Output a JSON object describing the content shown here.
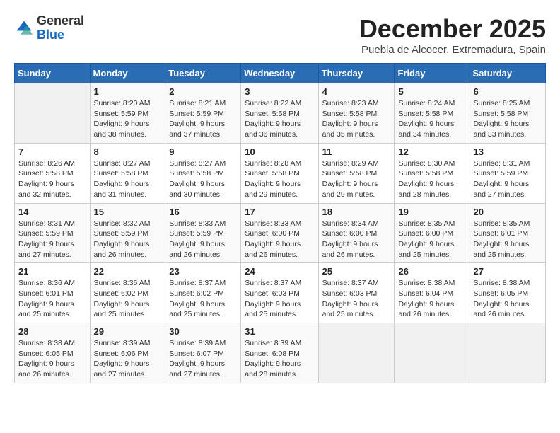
{
  "logo": {
    "general": "General",
    "blue": "Blue"
  },
  "header": {
    "month": "December 2025",
    "location": "Puebla de Alcocer, Extremadura, Spain"
  },
  "weekdays": [
    "Sunday",
    "Monday",
    "Tuesday",
    "Wednesday",
    "Thursday",
    "Friday",
    "Saturday"
  ],
  "weeks": [
    [
      {
        "day": "",
        "info": ""
      },
      {
        "day": "1",
        "info": "Sunrise: 8:20 AM\nSunset: 5:59 PM\nDaylight: 9 hours\nand 38 minutes."
      },
      {
        "day": "2",
        "info": "Sunrise: 8:21 AM\nSunset: 5:59 PM\nDaylight: 9 hours\nand 37 minutes."
      },
      {
        "day": "3",
        "info": "Sunrise: 8:22 AM\nSunset: 5:58 PM\nDaylight: 9 hours\nand 36 minutes."
      },
      {
        "day": "4",
        "info": "Sunrise: 8:23 AM\nSunset: 5:58 PM\nDaylight: 9 hours\nand 35 minutes."
      },
      {
        "day": "5",
        "info": "Sunrise: 8:24 AM\nSunset: 5:58 PM\nDaylight: 9 hours\nand 34 minutes."
      },
      {
        "day": "6",
        "info": "Sunrise: 8:25 AM\nSunset: 5:58 PM\nDaylight: 9 hours\nand 33 minutes."
      }
    ],
    [
      {
        "day": "7",
        "info": "Sunrise: 8:26 AM\nSunset: 5:58 PM\nDaylight: 9 hours\nand 32 minutes."
      },
      {
        "day": "8",
        "info": "Sunrise: 8:27 AM\nSunset: 5:58 PM\nDaylight: 9 hours\nand 31 minutes."
      },
      {
        "day": "9",
        "info": "Sunrise: 8:27 AM\nSunset: 5:58 PM\nDaylight: 9 hours\nand 30 minutes."
      },
      {
        "day": "10",
        "info": "Sunrise: 8:28 AM\nSunset: 5:58 PM\nDaylight: 9 hours\nand 29 minutes."
      },
      {
        "day": "11",
        "info": "Sunrise: 8:29 AM\nSunset: 5:58 PM\nDaylight: 9 hours\nand 29 minutes."
      },
      {
        "day": "12",
        "info": "Sunrise: 8:30 AM\nSunset: 5:58 PM\nDaylight: 9 hours\nand 28 minutes."
      },
      {
        "day": "13",
        "info": "Sunrise: 8:31 AM\nSunset: 5:59 PM\nDaylight: 9 hours\nand 27 minutes."
      }
    ],
    [
      {
        "day": "14",
        "info": "Sunrise: 8:31 AM\nSunset: 5:59 PM\nDaylight: 9 hours\nand 27 minutes."
      },
      {
        "day": "15",
        "info": "Sunrise: 8:32 AM\nSunset: 5:59 PM\nDaylight: 9 hours\nand 26 minutes."
      },
      {
        "day": "16",
        "info": "Sunrise: 8:33 AM\nSunset: 5:59 PM\nDaylight: 9 hours\nand 26 minutes."
      },
      {
        "day": "17",
        "info": "Sunrise: 8:33 AM\nSunset: 6:00 PM\nDaylight: 9 hours\nand 26 minutes."
      },
      {
        "day": "18",
        "info": "Sunrise: 8:34 AM\nSunset: 6:00 PM\nDaylight: 9 hours\nand 26 minutes."
      },
      {
        "day": "19",
        "info": "Sunrise: 8:35 AM\nSunset: 6:00 PM\nDaylight: 9 hours\nand 25 minutes."
      },
      {
        "day": "20",
        "info": "Sunrise: 8:35 AM\nSunset: 6:01 PM\nDaylight: 9 hours\nand 25 minutes."
      }
    ],
    [
      {
        "day": "21",
        "info": "Sunrise: 8:36 AM\nSunset: 6:01 PM\nDaylight: 9 hours\nand 25 minutes."
      },
      {
        "day": "22",
        "info": "Sunrise: 8:36 AM\nSunset: 6:02 PM\nDaylight: 9 hours\nand 25 minutes."
      },
      {
        "day": "23",
        "info": "Sunrise: 8:37 AM\nSunset: 6:02 PM\nDaylight: 9 hours\nand 25 minutes."
      },
      {
        "day": "24",
        "info": "Sunrise: 8:37 AM\nSunset: 6:03 PM\nDaylight: 9 hours\nand 25 minutes."
      },
      {
        "day": "25",
        "info": "Sunrise: 8:37 AM\nSunset: 6:03 PM\nDaylight: 9 hours\nand 25 minutes."
      },
      {
        "day": "26",
        "info": "Sunrise: 8:38 AM\nSunset: 6:04 PM\nDaylight: 9 hours\nand 26 minutes."
      },
      {
        "day": "27",
        "info": "Sunrise: 8:38 AM\nSunset: 6:05 PM\nDaylight: 9 hours\nand 26 minutes."
      }
    ],
    [
      {
        "day": "28",
        "info": "Sunrise: 8:38 AM\nSunset: 6:05 PM\nDaylight: 9 hours\nand 26 minutes."
      },
      {
        "day": "29",
        "info": "Sunrise: 8:39 AM\nSunset: 6:06 PM\nDaylight: 9 hours\nand 27 minutes."
      },
      {
        "day": "30",
        "info": "Sunrise: 8:39 AM\nSunset: 6:07 PM\nDaylight: 9 hours\nand 27 minutes."
      },
      {
        "day": "31",
        "info": "Sunrise: 8:39 AM\nSunset: 6:08 PM\nDaylight: 9 hours\nand 28 minutes."
      },
      {
        "day": "",
        "info": ""
      },
      {
        "day": "",
        "info": ""
      },
      {
        "day": "",
        "info": ""
      }
    ]
  ]
}
